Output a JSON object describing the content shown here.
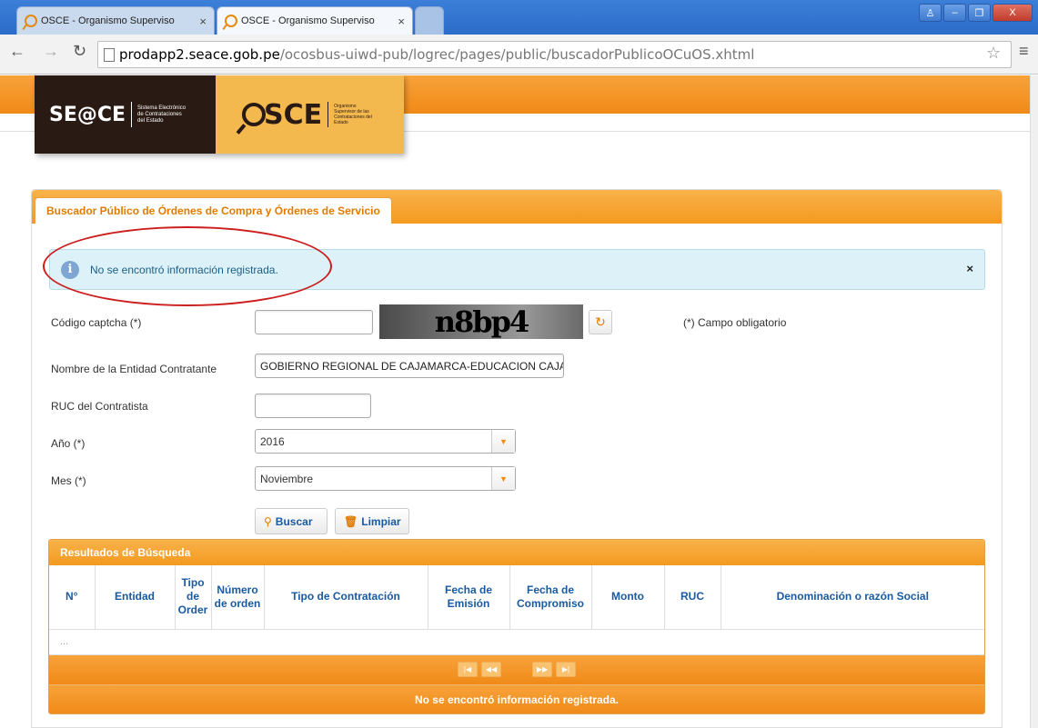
{
  "browser": {
    "tabs": [
      {
        "title": "OSCE - Organismo Superviso",
        "close": "×"
      },
      {
        "title": "OSCE - Organismo Superviso",
        "close": "×"
      }
    ],
    "url_domain": "prodapp2.seace.gob.pe",
    "url_path": "/ocosbus-uiwd-pub/logrec/pages/public/buscadorPublicoOCuOS.xhtml",
    "window_buttons": [
      "♙",
      "–",
      "❐",
      "X"
    ]
  },
  "logos": {
    "seace_big": "SE@CE",
    "seace_small": "Sistema Electrónico de Contrataciones del Estado",
    "osce_big": "SCE",
    "osce_small": "Organismo Supervisor de las Contrataciones del Estado"
  },
  "panel": {
    "tab_label": "Buscador Público de Órdenes de Compra y Órdenes de Servicio"
  },
  "alert": {
    "message": "No se encontró información registrada.",
    "close": "×"
  },
  "form": {
    "captcha_label": "Código captcha (*)",
    "captcha_value": "",
    "captcha_text": "n8bp4",
    "required_note": "(*) Campo obligatorio",
    "entidad_label": "Nombre de la Entidad Contratante",
    "entidad_value": "GOBIERNO REGIONAL DE CAJAMARCA-EDUCACION CAJAMARC",
    "ruc_label": "RUC del Contratista",
    "ruc_value": "",
    "anio_label": "Año (*)",
    "anio_value": "2016",
    "mes_label": "Mes (*)",
    "mes_value": "Noviembre",
    "buscar_label": "Buscar",
    "limpiar_label": "Limpiar"
  },
  "results": {
    "title": "Resultados de Búsqueda",
    "columns": [
      {
        "label": "N°"
      },
      {
        "label": "Entidad"
      },
      {
        "label": "Tipo de Order"
      },
      {
        "label": "Número de orden"
      },
      {
        "label": "Tipo de Contratación"
      },
      {
        "label": "Fecha de Emisión"
      },
      {
        "label": "Fecha de Compromiso"
      },
      {
        "label": "Monto"
      },
      {
        "label": "RUC"
      },
      {
        "label": "Denominación o razón Social"
      }
    ],
    "empty_row": "...",
    "pager": [
      "|◀",
      "◀◀",
      "▶▶",
      "▶|"
    ],
    "footer_message": "No se encontró información registrada."
  }
}
